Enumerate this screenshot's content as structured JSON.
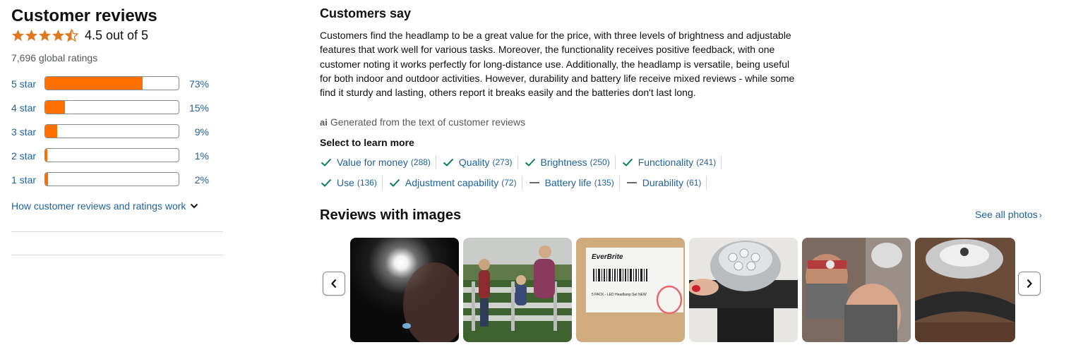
{
  "reviews": {
    "title": "Customer reviews",
    "rating_value": 4.5,
    "rating_text": "4.5 out of 5",
    "global_ratings": "7,696 global ratings",
    "histogram": [
      {
        "label": "5 star",
        "percent_text": "73%",
        "fraction": 0.73
      },
      {
        "label": "4 star",
        "percent_text": "15%",
        "fraction": 0.15
      },
      {
        "label": "3 star",
        "percent_text": "9%",
        "fraction": 0.09
      },
      {
        "label": "2 star",
        "percent_text": "1%",
        "fraction": 0.01
      },
      {
        "label": "1 star",
        "percent_text": "2%",
        "fraction": 0.02
      }
    ],
    "how_link": "How customer reviews and ratings work"
  },
  "customers_say": {
    "title": "Customers say",
    "summary": "Customers find the headlamp to be a great value for the price, with three levels of brightness and adjustable features that work well for various tasks. Moreover, the functionality receives positive feedback, with one customer noting it works perfectly for long-distance use. Additionally, the headlamp is versatile, being useful for both indoor and outdoor activities. However, durability and battery life receive mixed reviews - while some find it sturdy and lasting, others report it breaks easily and the batteries don't last long.",
    "ai_icon": "ai",
    "ai_note": "Generated from the text of customer reviews",
    "learn_more": "Select to learn more",
    "aspects_row1": [
      {
        "label": "Value for money",
        "count": "(288)",
        "sentiment": "positive"
      },
      {
        "label": "Quality",
        "count": "(273)",
        "sentiment": "positive"
      },
      {
        "label": "Brightness",
        "count": "(250)",
        "sentiment": "positive"
      },
      {
        "label": "Functionality",
        "count": "(241)",
        "sentiment": "positive"
      }
    ],
    "aspects_row2": [
      {
        "label": "Use",
        "count": "(136)",
        "sentiment": "positive"
      },
      {
        "label": "Adjustment capability",
        "count": "(72)",
        "sentiment": "positive"
      },
      {
        "label": "Battery life",
        "count": "(135)",
        "sentiment": "mixed"
      },
      {
        "label": "Durability",
        "count": "(61)",
        "sentiment": "mixed"
      }
    ]
  },
  "images": {
    "title": "Reviews with images",
    "see_all": "See all photos",
    "photo2_label": "EverBrite",
    "photo2_caption": "5 PACK - LED Headlamp Set NEW"
  },
  "colors": {
    "accent_orange": "#ff6f00",
    "star_orange": "#de7921",
    "link_blue": "#2162a1",
    "check_green": "#067d62"
  }
}
